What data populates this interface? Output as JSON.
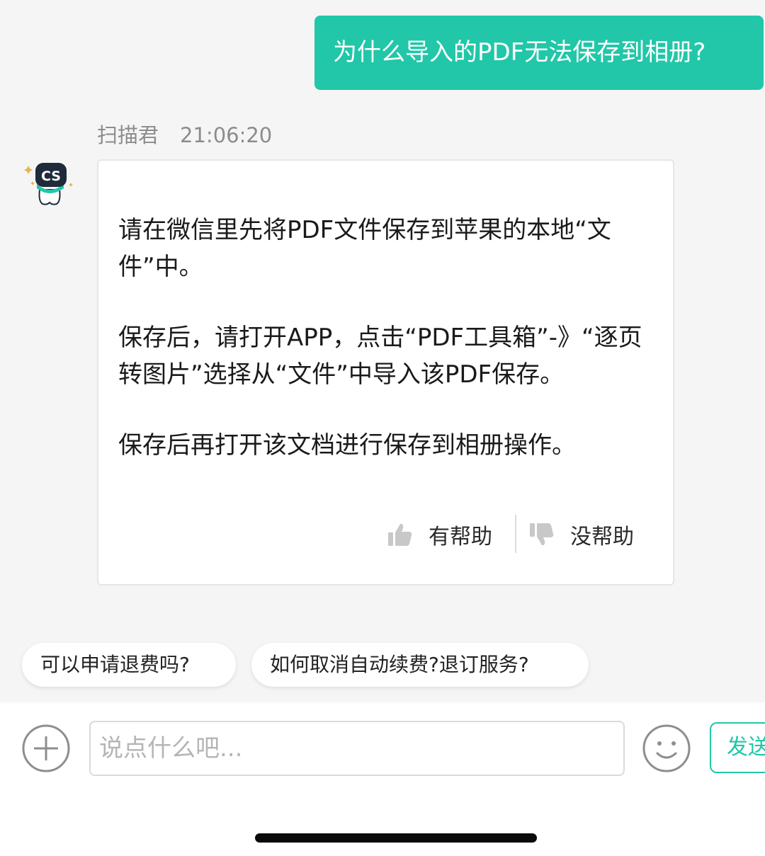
{
  "user_message": "为什么导入的PDF无法保存到相册?",
  "bot": {
    "name": "扫描君",
    "time": "21:06:20",
    "avatar_text": "CS",
    "paragraphs": [
      "请在微信里先将PDF文件保存到苹果的本地“文件”中。",
      "保存后，请打开APP，点击“PDF工具箱”-》“逐页转图片”选择从“文件”中导入该PDF保存。",
      "保存后再打开该文档进行保存到相册操作。"
    ],
    "feedback": {
      "helpful_label": "有帮助",
      "unhelpful_label": "没帮助"
    }
  },
  "suggestions": [
    "可以申请退费吗?",
    "如何取消自动续费?退订服务?"
  ],
  "input": {
    "placeholder": "说点什么吧...",
    "value": "",
    "send_label": "发送"
  },
  "colors": {
    "accent": "#21c7a8",
    "background": "#f5f5f5",
    "meta_text": "#8c8c8c"
  },
  "icons": {
    "plus": "plus-circle-icon",
    "emoji": "smiley-icon",
    "helpful": "thumbs-up-icon",
    "unhelpful": "thumbs-down-icon"
  }
}
